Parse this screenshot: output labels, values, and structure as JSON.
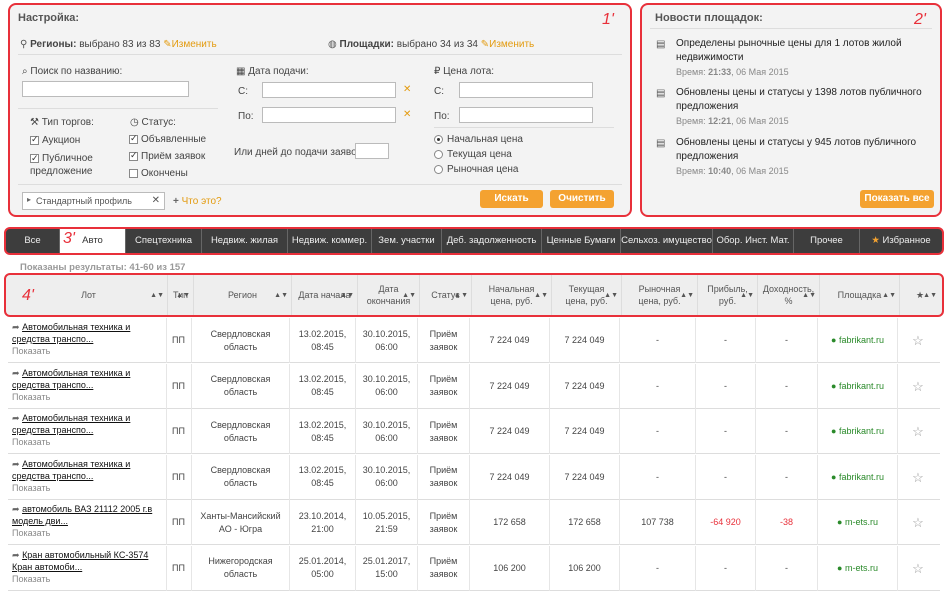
{
  "settings": {
    "title": "Настройка:",
    "marker": "1'",
    "regions_label": "Регионы:",
    "regions_value": "выбрано 83 из 83",
    "regions_change": "Изменить",
    "sites_label": "Площадки:",
    "sites_value": "выбрано 34 из 34",
    "sites_change": "Изменить",
    "search_label": "Поиск по названию:",
    "date_label": "Дата подачи:",
    "price_label": "Цена лота:",
    "from": "С:",
    "to": "По:",
    "trade_type_label": "Тип торгов:",
    "trade_types": [
      "Аукцион",
      "Публичное предложение"
    ],
    "status_label": "Статус:",
    "statuses": [
      "Объявленные",
      "Приём заявок",
      "Окончены"
    ],
    "days_label": "Или дней до подачи заявок*:",
    "price_types": [
      "Начальная цена",
      "Текущая цена",
      "Рыночная цена"
    ],
    "profile_placeholder": "Стандартный профиль",
    "what_is_it": "Что это?",
    "search_button": "Искать",
    "clear_button": "Очистить"
  },
  "news": {
    "title": "Новости площадок:",
    "marker": "2'",
    "items": [
      {
        "title": "Определены рыночные цены для 1 лотов жилой недвижимости",
        "time_label": "Время:",
        "time": "21:33",
        "date": ", 06 Мая 2015"
      },
      {
        "title": "Обновлены цены и статусы у 1398 лотов публичного предложения",
        "time_label": "Время:",
        "time": "12:21",
        "date": ", 06 Мая 2015"
      },
      {
        "title": "Обновлены цены и статусы у 945 лотов публичного предложения",
        "time_label": "Время:",
        "time": "10:40",
        "date": ", 06 Мая 2015"
      }
    ],
    "show_all": "Показать все"
  },
  "tabs": {
    "marker": "3'",
    "items": [
      "Все",
      "Авто",
      "Спецтехника",
      "Недвиж. жилая",
      "Недвиж. коммер.",
      "Зем. участки",
      "Деб. задолженность",
      "Ценные Бумаги",
      "Сельхоз. имущество",
      "Обор. Инст. Мат.",
      "Прочее",
      "Избранное"
    ]
  },
  "results": "Показаны результаты: 41-60 из 157",
  "table": {
    "marker": "4'",
    "headers": [
      "Лот",
      "Тип",
      "Регион",
      "Дата начала",
      "Дата окончания",
      "Статус",
      "Начальная цена, руб.",
      "Текущая цена, руб.",
      "Рыночная цена, руб.",
      "Прибыль, руб.",
      "Доходность, %",
      "Площадка",
      "★"
    ],
    "show_label": "Показать",
    "rows": [
      {
        "lot": "Автомобильная техника и средства транспо...",
        "type": "ПП",
        "region": "Свердловская область",
        "start": "13.02.2015, 08:45",
        "end": "30.10.2015, 06:00",
        "status": "Приём заявок",
        "initial": "7 224 049",
        "current": "7 224 049",
        "market": "-",
        "profit": "-",
        "yield": "-",
        "site": "fabrikant.ru"
      },
      {
        "lot": "Автомобильная техника и средства транспо...",
        "type": "ПП",
        "region": "Свердловская область",
        "start": "13.02.2015, 08:45",
        "end": "30.10.2015, 06:00",
        "status": "Приём заявок",
        "initial": "7 224 049",
        "current": "7 224 049",
        "market": "-",
        "profit": "-",
        "yield": "-",
        "site": "fabrikant.ru"
      },
      {
        "lot": "Автомобильная техника и средства транспо...",
        "type": "ПП",
        "region": "Свердловская область",
        "start": "13.02.2015, 08:45",
        "end": "30.10.2015, 06:00",
        "status": "Приём заявок",
        "initial": "7 224 049",
        "current": "7 224 049",
        "market": "-",
        "profit": "-",
        "yield": "-",
        "site": "fabrikant.ru"
      },
      {
        "lot": "Автомобильная техника и средства транспо...",
        "type": "ПП",
        "region": "Свердловская область",
        "start": "13.02.2015, 08:45",
        "end": "30.10.2015, 06:00",
        "status": "Приём заявок",
        "initial": "7 224 049",
        "current": "7 224 049",
        "market": "-",
        "profit": "-",
        "yield": "-",
        "site": "fabrikant.ru"
      },
      {
        "lot": "автомобиль ВАЗ 21112 2005 г.в модель дви...",
        "type": "ПП",
        "region": "Ханты-Мансийский АО - Югра",
        "start": "23.10.2014, 21:00",
        "end": "10.05.2015, 21:59",
        "status": "Приём заявок",
        "initial": "172 658",
        "current": "172 658",
        "market": "107 738",
        "profit": "-64 920",
        "yield": "-38",
        "site": "m-ets.ru"
      },
      {
        "lot": "Кран автомобильный КС-3574 Кран автомоби...",
        "type": "ПП",
        "region": "Нижегородская область",
        "start": "25.01.2014, 05:00",
        "end": "25.01.2017, 15:00",
        "status": "Приём заявок",
        "initial": "106 200",
        "current": "106 200",
        "market": "-",
        "profit": "-",
        "yield": "-",
        "site": "m-ets.ru"
      }
    ]
  }
}
